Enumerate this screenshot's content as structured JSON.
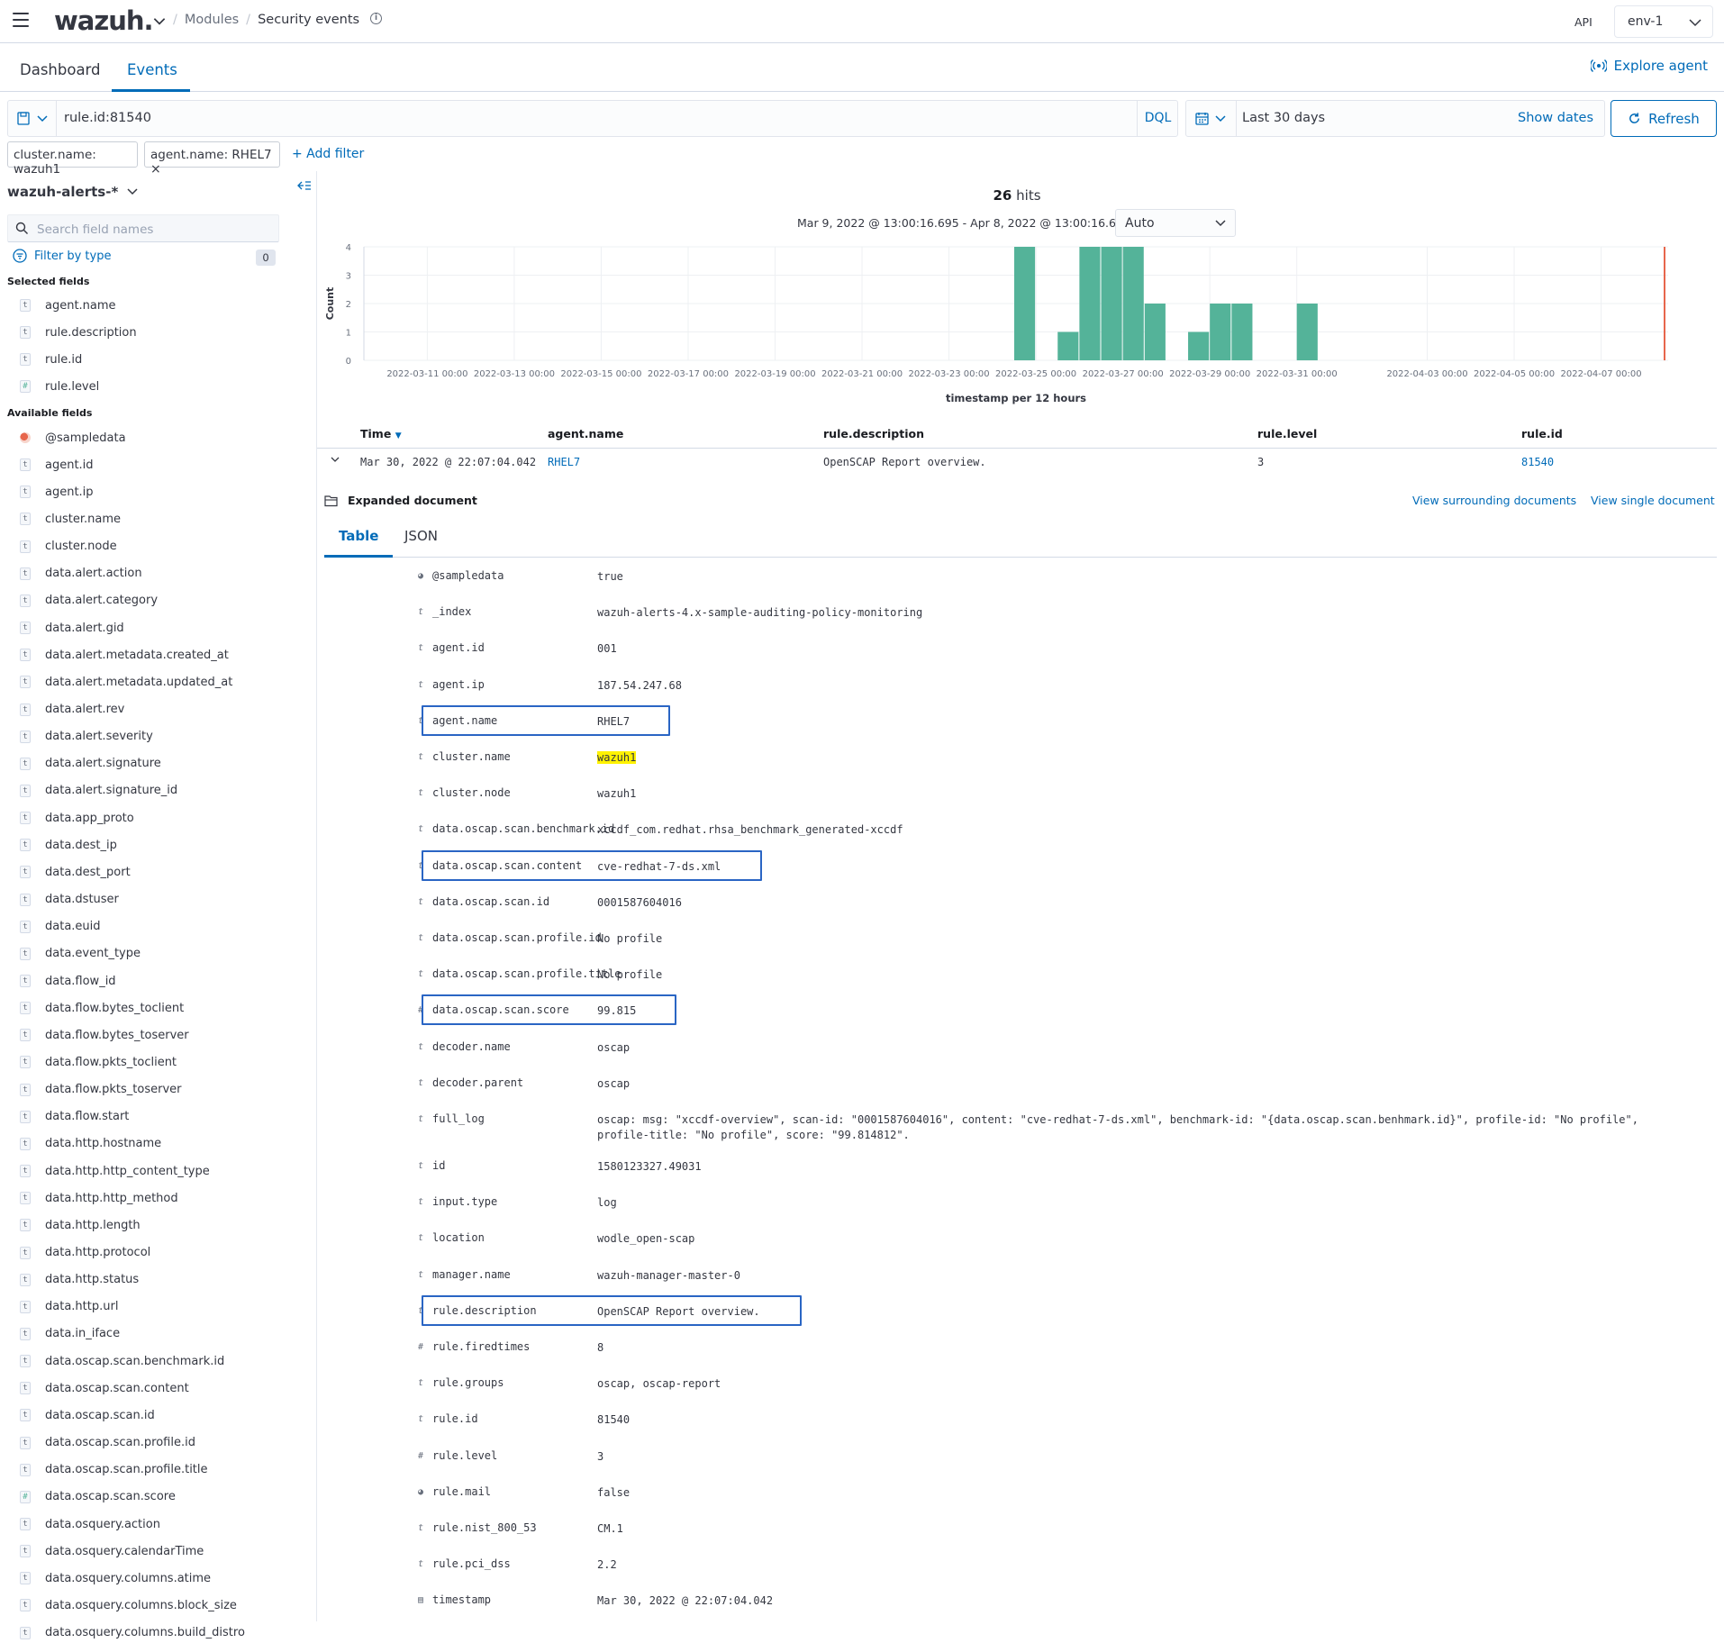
{
  "app": {
    "logo": "wazuh.",
    "api_label": "API",
    "env": "env-1"
  },
  "breadcrumbs": [
    "Modules",
    "Security events"
  ],
  "tabs": [
    {
      "label": "Dashboard"
    },
    {
      "label": "Events"
    }
  ],
  "explore_agent": "Explore agent",
  "query": {
    "text": "rule.id:81540",
    "language": "DQL"
  },
  "date": {
    "value": "Last 30 days",
    "show_dates": "Show dates",
    "refresh": "Refresh"
  },
  "filters": [
    {
      "label": "cluster.name: wazuh1"
    },
    {
      "label": "agent.name: RHEL7"
    }
  ],
  "add_filter": "+ Add filter",
  "sidebar": {
    "index_pattern": "wazuh-alerts-*",
    "search_placeholder": "Search field names",
    "filter_by_type": "Filter by type",
    "filter_count": "0",
    "selected_title": "Selected fields",
    "available_title": "Available fields",
    "selected": [
      {
        "type": "t",
        "name": "agent.name"
      },
      {
        "type": "t",
        "name": "rule.description"
      },
      {
        "type": "t",
        "name": "rule.id"
      },
      {
        "type": "#",
        "name": "rule.level"
      }
    ],
    "available": [
      {
        "type": "bool",
        "name": "@sampledata"
      },
      {
        "type": "t",
        "name": "agent.id"
      },
      {
        "type": "t",
        "name": "agent.ip"
      },
      {
        "type": "t",
        "name": "cluster.name"
      },
      {
        "type": "t",
        "name": "cluster.node"
      },
      {
        "type": "t",
        "name": "data.alert.action"
      },
      {
        "type": "t",
        "name": "data.alert.category"
      },
      {
        "type": "t",
        "name": "data.alert.gid"
      },
      {
        "type": "t",
        "name": "data.alert.metadata.created_at"
      },
      {
        "type": "t",
        "name": "data.alert.metadata.updated_at"
      },
      {
        "type": "t",
        "name": "data.alert.rev"
      },
      {
        "type": "t",
        "name": "data.alert.severity"
      },
      {
        "type": "t",
        "name": "data.alert.signature"
      },
      {
        "type": "t",
        "name": "data.alert.signature_id"
      },
      {
        "type": "t",
        "name": "data.app_proto"
      },
      {
        "type": "t",
        "name": "data.dest_ip"
      },
      {
        "type": "t",
        "name": "data.dest_port"
      },
      {
        "type": "t",
        "name": "data.dstuser"
      },
      {
        "type": "t",
        "name": "data.euid"
      },
      {
        "type": "t",
        "name": "data.event_type"
      },
      {
        "type": "t",
        "name": "data.flow_id"
      },
      {
        "type": "t",
        "name": "data.flow.bytes_toclient"
      },
      {
        "type": "t",
        "name": "data.flow.bytes_toserver"
      },
      {
        "type": "t",
        "name": "data.flow.pkts_toclient"
      },
      {
        "type": "t",
        "name": "data.flow.pkts_toserver"
      },
      {
        "type": "t",
        "name": "data.flow.start"
      },
      {
        "type": "t",
        "name": "data.http.hostname"
      },
      {
        "type": "t",
        "name": "data.http.http_content_type"
      },
      {
        "type": "t",
        "name": "data.http.http_method"
      },
      {
        "type": "t",
        "name": "data.http.length"
      },
      {
        "type": "t",
        "name": "data.http.protocol"
      },
      {
        "type": "t",
        "name": "data.http.status"
      },
      {
        "type": "t",
        "name": "data.http.url"
      },
      {
        "type": "t",
        "name": "data.in_iface"
      },
      {
        "type": "t",
        "name": "data.oscap.scan.benchmark.id"
      },
      {
        "type": "t",
        "name": "data.oscap.scan.content"
      },
      {
        "type": "t",
        "name": "data.oscap.scan.id"
      },
      {
        "type": "t",
        "name": "data.oscap.scan.profile.id"
      },
      {
        "type": "t",
        "name": "data.oscap.scan.profile.title"
      },
      {
        "type": "#",
        "name": "data.oscap.scan.score"
      },
      {
        "type": "t",
        "name": "data.osquery.action"
      },
      {
        "type": "t",
        "name": "data.osquery.calendarTime"
      },
      {
        "type": "t",
        "name": "data.osquery.columns.atime"
      },
      {
        "type": "t",
        "name": "data.osquery.columns.block_size"
      },
      {
        "type": "t",
        "name": "data.osquery.columns.build_distro"
      }
    ]
  },
  "hits": {
    "count": "26",
    "label": "hits"
  },
  "time_range": "Mar 9, 2022 @ 13:00:16.695 - Apr 8, 2022 @ 13:00:16.695",
  "interval": "Auto",
  "chart_data": {
    "type": "bar",
    "ylabel": "Count",
    "xlabel": "timestamp per 12 hours",
    "ylim": [
      0,
      4
    ],
    "yticks": [
      0,
      1,
      2,
      3,
      4
    ],
    "xticks": [
      "2022-03-11 00:00",
      "2022-03-13 00:00",
      "2022-03-15 00:00",
      "2022-03-17 00:00",
      "2022-03-19 00:00",
      "2022-03-21 00:00",
      "2022-03-23 00:00",
      "2022-03-25 00:00",
      "2022-03-27 00:00",
      "2022-03-29 00:00",
      "2022-03-31 00:00",
      "2022-04-03 00:00",
      "2022-04-05 00:00",
      "2022-04-07 00:00"
    ],
    "bars": [
      {
        "x": "2022-03-24 12:00",
        "value": 4
      },
      {
        "x": "2022-03-25 12:00",
        "value": 1
      },
      {
        "x": "2022-03-26 00:00",
        "value": 4
      },
      {
        "x": "2022-03-26 12:00",
        "value": 4
      },
      {
        "x": "2022-03-27 00:00",
        "value": 4
      },
      {
        "x": "2022-03-27 12:00",
        "value": 2
      },
      {
        "x": "2022-03-28 12:00",
        "value": 1
      },
      {
        "x": "2022-03-29 00:00",
        "value": 2
      },
      {
        "x": "2022-03-29 12:00",
        "value": 2
      },
      {
        "x": "2022-03-31 00:00",
        "value": 2
      }
    ],
    "bar_color": "#54b399",
    "now_marker_color": "#e7664c",
    "grid": true
  },
  "table": {
    "headers": [
      "Time",
      "agent.name",
      "rule.description",
      "rule.level",
      "rule.id"
    ],
    "row": {
      "time": "Mar 30, 2022 @ 22:07:04.042",
      "agent": "RHEL7",
      "description": "OpenSCAP Report overview.",
      "level": "3",
      "id": "81540"
    }
  },
  "expanded": {
    "title": "Expanded document",
    "view_surrounding": "View surrounding documents",
    "view_single": "View single document",
    "tab_table": "Table",
    "tab_json": "JSON",
    "fields": [
      {
        "type": "bool",
        "key": "@sampledata",
        "value": "true"
      },
      {
        "type": "t",
        "key": "_index",
        "value": "wazuh-alerts-4.x-sample-auditing-policy-monitoring"
      },
      {
        "type": "t",
        "key": "agent.id",
        "value": "001",
        "link": true
      },
      {
        "type": "t",
        "key": "agent.ip",
        "value": "187.54.247.68"
      },
      {
        "type": "t",
        "key": "agent.name",
        "value": "RHEL7",
        "link": true,
        "boxed": true
      },
      {
        "type": "t",
        "key": "cluster.name",
        "value": "wazuh1",
        "highlight": true
      },
      {
        "type": "t",
        "key": "cluster.node",
        "value": "wazuh1"
      },
      {
        "type": "t",
        "key": "data.oscap.scan.benchmark.id",
        "value": "xccdf_com.redhat.rhsa_benchmark_generated-xccdf"
      },
      {
        "type": "t",
        "key": "data.oscap.scan.content",
        "value": "cve-redhat-7-ds.xml",
        "boxed": true
      },
      {
        "type": "t",
        "key": "data.oscap.scan.id",
        "value": "0001587604016"
      },
      {
        "type": "t",
        "key": "data.oscap.scan.profile.id",
        "value": "No profile"
      },
      {
        "type": "t",
        "key": "data.oscap.scan.profile.title",
        "value": "No profile"
      },
      {
        "type": "#",
        "key": "data.oscap.scan.score",
        "value": "99.815",
        "boxed": true
      },
      {
        "type": "t",
        "key": "decoder.name",
        "value": "oscap"
      },
      {
        "type": "t",
        "key": "decoder.parent",
        "value": "oscap"
      },
      {
        "type": "t",
        "key": "full_log",
        "value": "oscap: msg: \"xccdf-overview\", scan-id: \"0001587604016\", content: \"cve-redhat-7-ds.xml\", benchmark-id: \"{data.oscap.scan.benhmark.id}\", profile-id: \"No profile\", profile-title: \"No profile\", score: \"99.814812\"."
      },
      {
        "type": "t",
        "key": "id",
        "value": "1580123327.49031"
      },
      {
        "type": "t",
        "key": "input.type",
        "value": "log"
      },
      {
        "type": "t",
        "key": "location",
        "value": "wodle_open-scap"
      },
      {
        "type": "t",
        "key": "manager.name",
        "value": "wazuh-manager-master-0"
      },
      {
        "type": "t",
        "key": "rule.description",
        "value": "OpenSCAP Report overview.",
        "boxed": true
      },
      {
        "type": "#",
        "key": "rule.firedtimes",
        "value": "8"
      },
      {
        "type": "t",
        "key": "rule.groups",
        "value": "oscap, oscap-report"
      },
      {
        "type": "t",
        "key": "rule.id",
        "value": "81540",
        "link": true
      },
      {
        "type": "#",
        "key": "rule.level",
        "value": "3"
      },
      {
        "type": "bool",
        "key": "rule.mail",
        "value": "false"
      },
      {
        "type": "t",
        "key": "rule.nist_800_53",
        "value": "CM.1"
      },
      {
        "type": "t",
        "key": "rule.pci_dss",
        "value": "2.2"
      },
      {
        "type": "date",
        "key": "timestamp",
        "value": "Mar 30, 2022 @ 22:07:04.042"
      }
    ]
  }
}
